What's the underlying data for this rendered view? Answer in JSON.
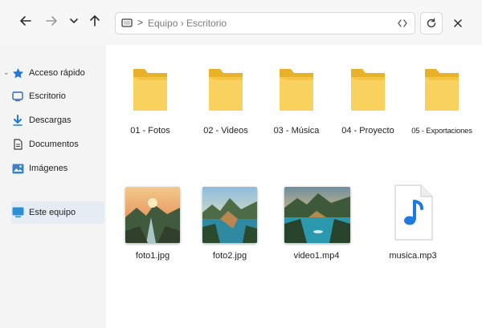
{
  "window": {
    "nav": {
      "back_icon": "arrow-left-icon",
      "forward_icon": "arrow-right-icon",
      "recent_icon": "chevron-down-icon",
      "up_icon": "arrow-up-icon"
    },
    "address": {
      "separator": ">",
      "text": "Equipo › Escritorio"
    }
  },
  "sidebar": {
    "items": [
      {
        "label": "Acceso rápido",
        "icon": "star-icon"
      },
      {
        "label": "Escritorio",
        "icon": "desktop-icon"
      },
      {
        "label": "Descargas",
        "icon": "download-icon"
      },
      {
        "label": "Documentos",
        "icon": "document-icon"
      },
      {
        "label": "Imágenes",
        "icon": "image-icon"
      },
      {
        "label": "Este equipo",
        "icon": "computer-icon"
      }
    ]
  },
  "folders": [
    {
      "label": "01 - Fotos"
    },
    {
      "label": "02 - Videos"
    },
    {
      "label": "03 - Música"
    },
    {
      "label": "04 - Proyecto"
    },
    {
      "label": "05 - Exportaciones"
    }
  ],
  "files": [
    {
      "label": "foto1.jpg",
      "kind": "image"
    },
    {
      "label": "foto2.jpg",
      "kind": "image"
    },
    {
      "label": "video1.mp4",
      "kind": "video"
    },
    {
      "label": "musica.mp3",
      "kind": "audio"
    }
  ],
  "colors": {
    "accent": "#1f7ae0",
    "folder": "#f5c542",
    "folder_dark": "#e8b12a",
    "sidebar_selected": "#e6ecf3"
  }
}
